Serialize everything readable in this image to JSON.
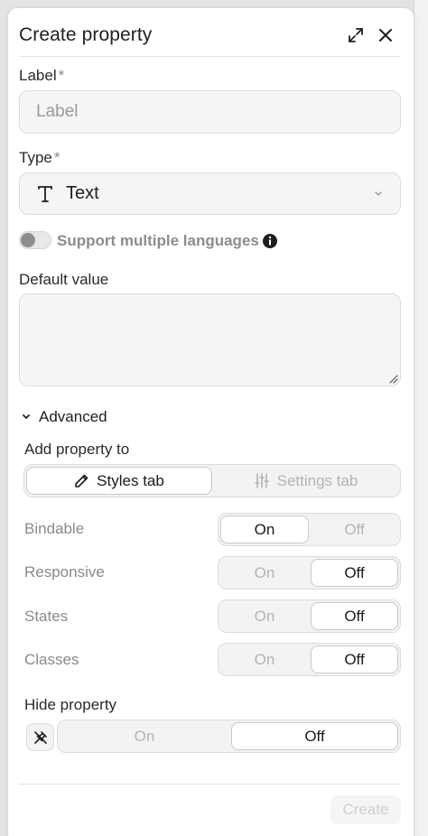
{
  "dialog": {
    "title": "Create property",
    "expand_icon": "expand-icon",
    "close_icon": "close-icon"
  },
  "label_field": {
    "label": "Label",
    "required_mark": "*",
    "placeholder": "Label"
  },
  "type_field": {
    "label": "Type",
    "required_mark": "*",
    "icon": "text-type-icon",
    "value": "Text"
  },
  "languages_toggle": {
    "label": "Support multiple languages",
    "enabled": false,
    "info_icon": "info-icon"
  },
  "default_value": {
    "label": "Default value",
    "value": ""
  },
  "advanced": {
    "label": "Advanced",
    "expanded": true,
    "add_property_to": {
      "label": "Add property to",
      "options": [
        {
          "label": "Styles tab",
          "icon": "pencil-icon",
          "selected": true
        },
        {
          "label": "Settings tab",
          "icon": "sliders-icon",
          "selected": false
        }
      ]
    },
    "rows": [
      {
        "label": "Bindable",
        "on": "On",
        "off": "Off",
        "selected": "On"
      },
      {
        "label": "Responsive",
        "on": "On",
        "off": "Off",
        "selected": "Off"
      },
      {
        "label": "States",
        "on": "On",
        "off": "Off",
        "selected": "Off"
      },
      {
        "label": "Classes",
        "on": "On",
        "off": "Off",
        "selected": "Off"
      }
    ],
    "hide_property": {
      "label": "Hide property",
      "pin_icon": "pin-off-icon",
      "on": "On",
      "off": "Off",
      "selected": "Off"
    }
  },
  "footer": {
    "create_label": "Create",
    "create_enabled": false
  },
  "colors": {
    "accent_text": "#1f1f1f",
    "muted_text": "#8a8a8a",
    "field_bg": "#f5f5f5",
    "border": "#dcdcdc"
  }
}
